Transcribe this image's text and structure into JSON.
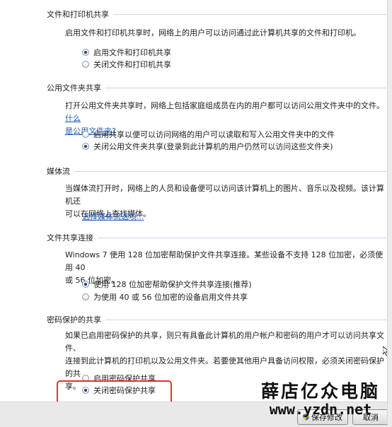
{
  "sections": {
    "file_printer": {
      "title": "文件和打印机共享",
      "description": "启用文件和打印机共享时，网络上的用户可以访问通过此计算机共享的文件和打印机。",
      "options": [
        {
          "label": "启用文件和打印机共享",
          "checked": true
        },
        {
          "label": "关闭文件和打印机共享",
          "checked": false
        }
      ]
    },
    "public_folder": {
      "title": "公用文件夹共享",
      "description_line1": "打开公用文件夹共享时，网络上包括家庭组成员在内的用户都可以访问公用文件夹中的文件。",
      "link_part1": "什么",
      "link_part2": "是公用文件夹?",
      "options": [
        {
          "label": "启用共享以便可以访问网络的用户可以读取和写入公用文件夹中的文件",
          "checked": false
        },
        {
          "label": "关闭公用文件夹共享(登录到此计算机的用户仍然可以访问这些文件夹)",
          "checked": true
        }
      ]
    },
    "media": {
      "title": "媒体流",
      "description_line1": "当媒体流打开时，网络上的人员和设备便可以访问该计算机上的图片、音乐以及视频。该计算机还",
      "description_line2": "可以在网络上查找媒体。",
      "link": "选择媒体流选项..."
    },
    "file_sharing_conn": {
      "title": "文件共享连接",
      "description_line1": "Windows 7 使用 128 位加密帮助保护文件共享连接。某些设备不支持 128 位加密，必须使用 40",
      "description_line2": "或 56 位加密。",
      "options": [
        {
          "label": "使用 128 位加密帮助保护文件共享连接(推荐)",
          "checked": true
        },
        {
          "label": "为使用 40 或 56 位加密的设备启用文件共享",
          "checked": false
        }
      ]
    },
    "password": {
      "title": "密码保护的共享",
      "description_line1": "如果已启用密码保护的共享，则只有具备此计算机的用户帐户和密码的用户才可以访问共享文件、",
      "description_line2": "连接到此计算机的打印机以及公用文件夹。若要使其他用户具备访问权限，必须关闭密码保护的共",
      "description_line3": "享。",
      "options": [
        {
          "label": "启用密码保护共享",
          "checked": false
        },
        {
          "label": "关闭密码保护共享",
          "checked": true
        }
      ]
    }
  },
  "footer": {
    "save_label": "保存修改",
    "cancel_label": "取消"
  },
  "watermark": {
    "title": "薛店亿众电脑",
    "url": "www.yzdn.net"
  },
  "colors": {
    "link": "#1d5ab8",
    "highlight": "#e4312b"
  }
}
